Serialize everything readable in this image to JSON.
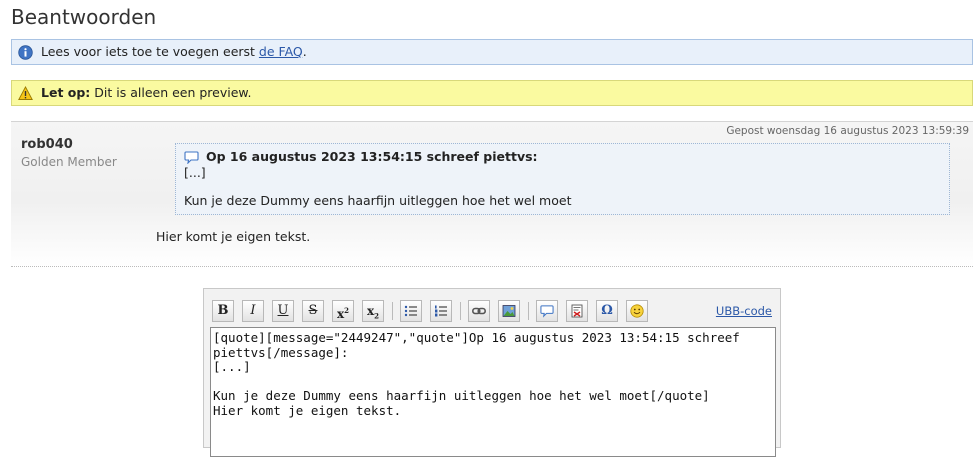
{
  "page": {
    "title": "Beantwoorden"
  },
  "notices": {
    "info": {
      "text": "Lees voor iets toe te voegen eerst ",
      "link": "de FAQ",
      "after": "."
    },
    "warning": {
      "bold": "Let op:",
      "text": " Dit is alleen een preview."
    }
  },
  "post": {
    "date": "Gepost woensdag 16 augustus 2023 13:59:39",
    "author": "rob040",
    "rank": "Golden Member",
    "quote": {
      "header": "Op 16 augustus 2023 13:54:15 schreef piettvs:",
      "dots": "[...]",
      "text": "Kun je deze Dummy eens haarfijn uitleggen hoe het wel moet"
    },
    "own_text": "Hier komt je eigen tekst."
  },
  "editor": {
    "buttons": {
      "bold": "B",
      "italic": "I",
      "underline": "U",
      "strike": "S",
      "sup": "x",
      "sup_mark": "2",
      "sub": "x",
      "sub_mark": "2"
    },
    "ubb_link": "UBB-code",
    "content": "[quote][message=\"2449247\",\"quote\"]Op 16 augustus 2023 13:54:15 schreef piettvs[/message]:\n[...]\n\nKun je deze Dummy eens haarfijn uitleggen hoe het wel moet[/quote]\nHier komt je eigen tekst."
  },
  "colors": {
    "link": "#2b58a8",
    "info_bg": "#e8f0fa",
    "warning_bg": "#fafaa0",
    "quote_bg": "#eef3f9"
  }
}
